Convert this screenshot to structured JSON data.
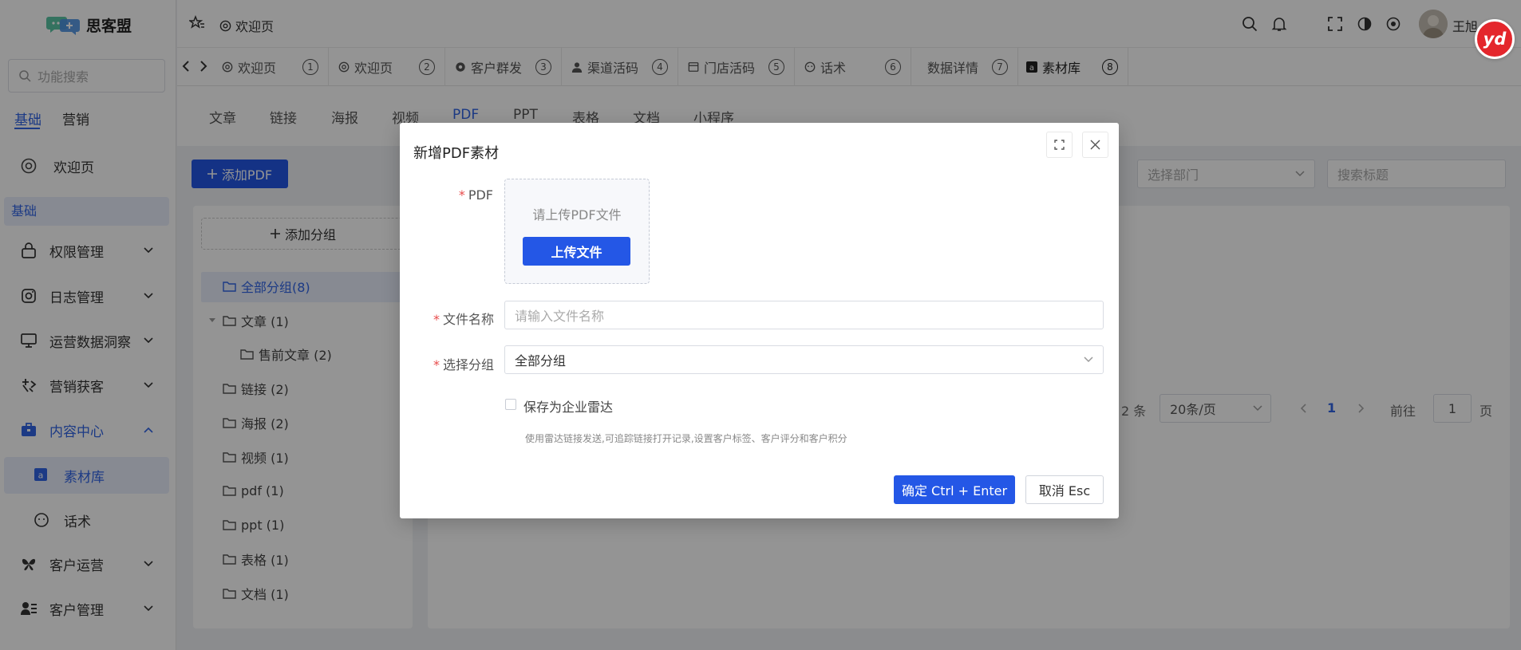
{
  "brand": {
    "name": "思客盟"
  },
  "sidebar": {
    "search_placeholder": "功能搜索",
    "mode_tabs": [
      "基础",
      "营销"
    ],
    "welcome": "欢迎页",
    "section_header": "基础",
    "menu": [
      "权限管理",
      "日志管理",
      "运营数据洞察",
      "营销获客",
      "内容中心",
      "素材库",
      "话术",
      "客户运营",
      "客户管理"
    ]
  },
  "topbar": {
    "page": "欢迎页",
    "user": "王旭"
  },
  "tabs": [
    {
      "label": "欢迎页",
      "num": "1"
    },
    {
      "label": "欢迎页",
      "num": "2"
    },
    {
      "label": "客户群发",
      "num": "3"
    },
    {
      "label": "渠道活码",
      "num": "4"
    },
    {
      "label": "门店活码",
      "num": "5"
    },
    {
      "label": "话术",
      "num": "6"
    },
    {
      "label": "数据详情",
      "num": "7"
    },
    {
      "label": "素材库",
      "num": "8"
    }
  ],
  "subtabs": [
    "文章",
    "链接",
    "海报",
    "视频",
    "PDF",
    "PPT",
    "表格",
    "文档",
    "小程序"
  ],
  "content": {
    "add_pdf": "添加PDF",
    "add_group": "添加分组",
    "dept_placeholder": "选择部门",
    "title_placeholder": "搜索标题",
    "tree": [
      "全部分组(8)",
      "文章 (1)",
      "售前文章 (2)",
      "链接 (2)",
      "海报 (2)",
      "视频 (1)",
      "pdf (1)",
      "ppt (1)",
      "表格 (1)",
      "文档 (1)"
    ],
    "pagination": {
      "total": "2 条",
      "size": "20条/页",
      "page": "1",
      "goto": "前往",
      "goto_val": "1",
      "unit": "页"
    }
  },
  "modal": {
    "title": "新增PDF素材",
    "pdf_label": "PDF",
    "upload_hint": "请上传PDF文件",
    "upload_btn": "上传文件",
    "name_label": "文件名称",
    "name_placeholder": "请输入文件名称",
    "group_label": "选择分组",
    "group_value": "全部分组",
    "radar_label": "保存为企业雷达",
    "radar_desc": "使用雷达链接发送,可追踪链接打开记录,设置客户标签、客户评分和客户积分",
    "confirm": "确定 Ctrl + Enter",
    "cancel": "取消 Esc"
  },
  "colors": {
    "primary": "#2457e6",
    "active": "#3165e5",
    "required": "#e84b4b"
  },
  "badge": {
    "text": "yd"
  }
}
